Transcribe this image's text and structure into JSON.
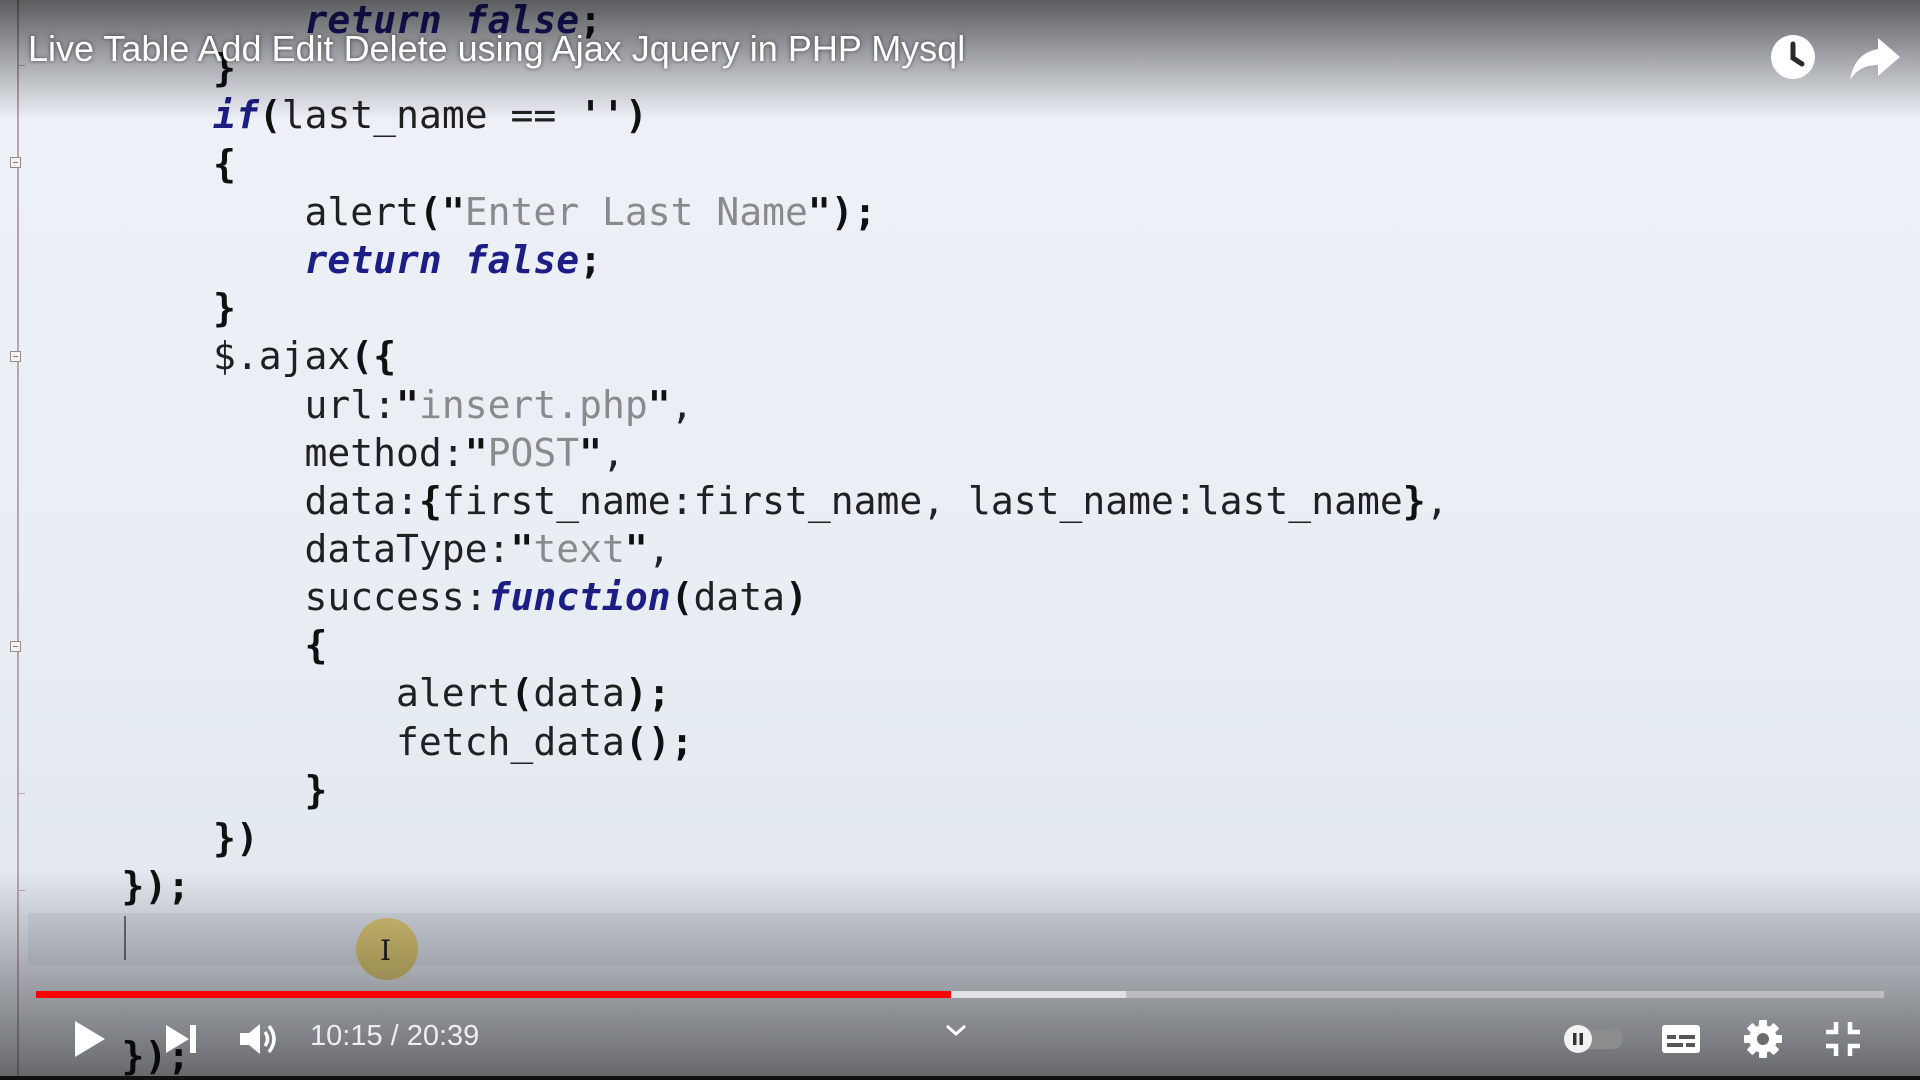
{
  "video": {
    "title": "Live Table Add Edit Delete using Ajax Jquery in PHP Mysql",
    "current_time": "10:15",
    "duration": "20:39",
    "time_display": "10:15 / 20:39",
    "progress_played": 0.495,
    "progress_buffered": 0.59
  },
  "controls": {
    "play_icon": "play-icon",
    "next_icon": "next-icon",
    "volume_icon": "volume-icon",
    "chevron_icon": "chevron-down-icon",
    "autoplay_icon": "autoplay-toggle-icon",
    "subtitles_icon": "subtitles-icon",
    "settings_icon": "gear-icon",
    "fullscreen_icon": "exit-fullscreen-icon",
    "watch_later_icon": "clock-icon",
    "share_icon": "share-icon"
  },
  "colors": {
    "progress_played": "#ff0000",
    "keyword": "#1d1d86",
    "string": "#8a8a8a"
  },
  "code": {
    "lines": [
      "            return false;",
      "        }",
      "        if(last_name == '')",
      "        {",
      "            alert(\"Enter Last Name\");",
      "            return false;",
      "        }",
      "        $.ajax({",
      "            url:\"insert.php\",",
      "            method:\"POST\",",
      "            data:{first_name:first_name, last_name:last_name},",
      "            dataType:\"text\",",
      "            success:function(data)",
      "            {",
      "                alert(data);",
      "                fetch_data();",
      "            }",
      "        })",
      "    });",
      "",
      "    });"
    ]
  }
}
